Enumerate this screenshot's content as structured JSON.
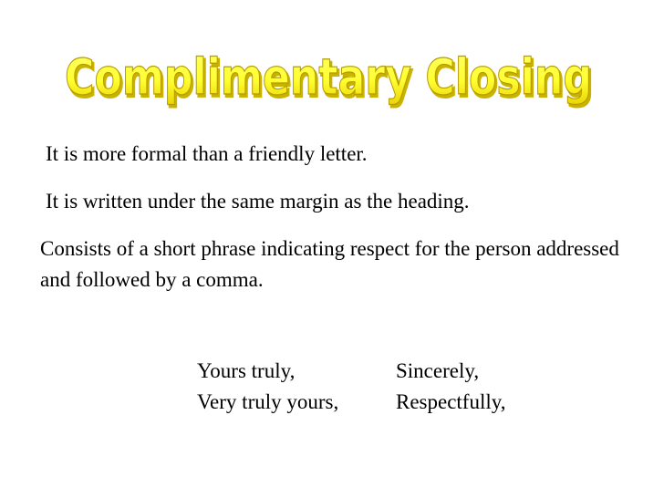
{
  "title": "Complimentary Closing",
  "colors": {
    "title_fill": "#ffff33",
    "title_shade": "#d9c400",
    "title_outline": "#b59a00",
    "text": "#000000",
    "background": "#ffffff"
  },
  "points": [
    "It is more formal than a friendly letter.",
    "It is written under the same margin as the heading.",
    "Consists of a short phrase indicating respect for the person addressed and followed by a comma."
  ],
  "examples": {
    "left": [
      "Yours truly,",
      "Very truly yours,"
    ],
    "right": [
      "Sincerely,",
      "Respectfully,"
    ]
  }
}
